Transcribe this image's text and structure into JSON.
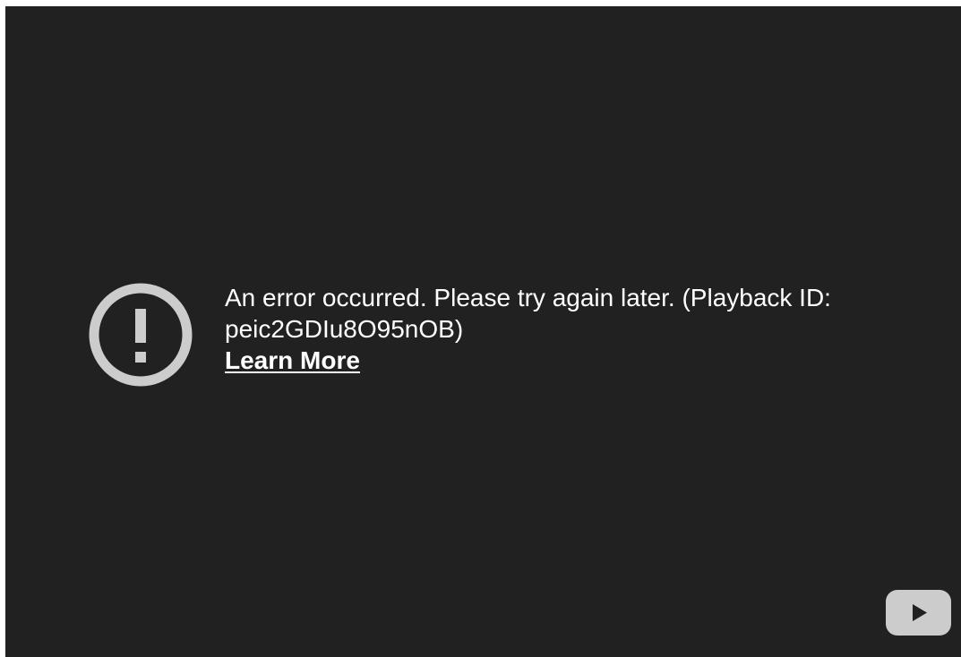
{
  "error": {
    "message_prefix": "An error occurred. Please try again later.",
    "playback_id_label": "(Playback ID: peic2GDIu8O95nOB)",
    "learn_more_label": "Learn More",
    "icon_name": "error-exclamation-icon"
  },
  "player": {
    "logo_icon_name": "youtube-logo-icon",
    "background_color": "#212121",
    "icon_color": "#cccccc",
    "text_color": "#ffffff"
  }
}
